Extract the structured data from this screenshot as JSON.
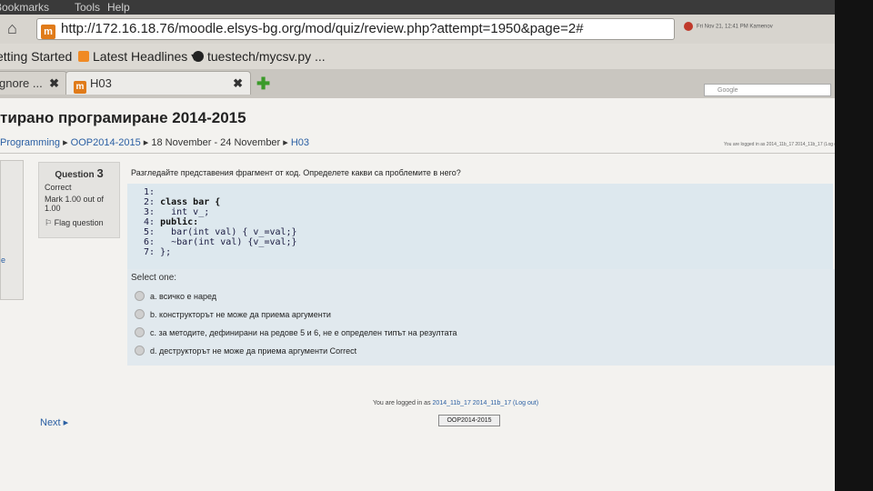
{
  "menubar": {
    "items": [
      "Bookmarks",
      "Tools",
      "Help"
    ]
  },
  "toolbar": {
    "url": "http://172.16.18.76/moodle.elsys-bg.org/mod/quiz/review.php?attempt=1950&page=2#",
    "favicon": "m",
    "tray_text": "Fri Nov 21, 12:41 PM   Kamenov"
  },
  "bookmarks": [
    {
      "label": "etting Started"
    },
    {
      "label": "Latest Headlines ▾"
    },
    {
      "label": "tuestech/mycsv.py ..."
    }
  ],
  "tabs": [
    {
      "label": "gnore ..."
    },
    {
      "label": "H03"
    }
  ],
  "search": {
    "placeholder": "Google"
  },
  "page": {
    "title": "тирано програмиране 2014-2015",
    "breadcrumb": [
      {
        "label": "Programming"
      },
      {
        "label": "OOP2014-2015"
      },
      {
        "label": "18 November - 24 November"
      },
      {
        "label": "H03"
      }
    ],
    "login_small": "You are logged in as 2014_11b_17 2014_11b_17 (Log out)"
  },
  "question": {
    "label": "Question",
    "number": "3",
    "state": "Correct",
    "mark": "Mark 1.00 out of 1.00",
    "flag": "Flag question",
    "text": "Разгледайте представения фрагмент от код. Определете какви са проблемите в него?",
    "code_lines": [
      {
        "num": "1:",
        "code": ""
      },
      {
        "num": "2:",
        "code": "class bar {"
      },
      {
        "num": "3:",
        "code": "  int v_;"
      },
      {
        "num": "4:",
        "code": "public:"
      },
      {
        "num": "5:",
        "code": "  bar(int val) { v_=val;}"
      },
      {
        "num": "6:",
        "code": "  ~bar(int val) {v_=val;}"
      },
      {
        "num": "7:",
        "code": "};"
      }
    ],
    "select_one": "Select one:",
    "options": [
      {
        "letter": "a.",
        "text": "всичко е наред"
      },
      {
        "letter": "b.",
        "text": "конструкторът не може да приема аргументи"
      },
      {
        "letter": "c.",
        "text": "за методите, дефинирани на редове 5 и 6, не е определен типът на резултата"
      },
      {
        "letter": "d.",
        "text": "деструкторът не може да приема аргументи Correct"
      }
    ]
  },
  "footer": {
    "next": "Next ▸",
    "logged_in_prefix": "You are logged in as",
    "user": "2014_11b_17 2014_11b_17",
    "logout": "(Log out)",
    "course_button": "OOP2014-2015"
  },
  "left_panel_link": "e"
}
